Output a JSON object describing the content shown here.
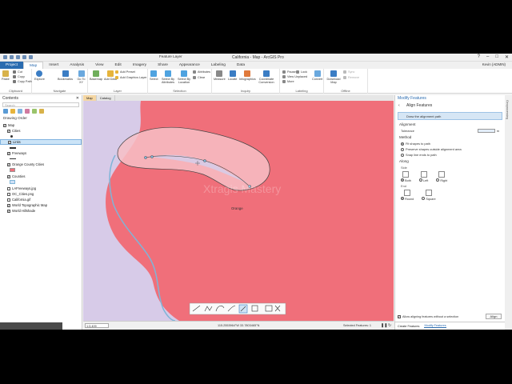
{
  "title_bar": {
    "contextual_tab": "Feature Layer",
    "window_title": "California - Map - ArcGIS Pro",
    "controls": [
      "?",
      "–",
      "□",
      "✕"
    ]
  },
  "ribbon_tabs": [
    "Project",
    "Map",
    "Insert",
    "Analysis",
    "View",
    "Edit",
    "Imagery",
    "Share",
    "Appearance",
    "Labeling",
    "Data"
  ],
  "active_tab": "Map",
  "user": "Kevin (ADMIN)",
  "ribbon": {
    "clipboard": {
      "label": "Clipboard",
      "paste": "Paste",
      "cut": "Cut",
      "copy": "Copy",
      "copy_path": "Copy Path"
    },
    "navigate": {
      "label": "Navigate",
      "explore": "Explore",
      "bookmarks": "Bookmarks",
      "go_to": "Go To XY"
    },
    "layer": {
      "label": "Layer",
      "basemap": "Basemap",
      "add_data": "Add Data",
      "add_preset": "Add Preset",
      "add_graphics": "Add Graphics Layer"
    },
    "selection": {
      "label": "Selection",
      "select": "Select",
      "by_attributes": "Select By Attributes",
      "by_location": "Select By Location",
      "attributes": "Attributes",
      "clear": "Clear"
    },
    "inquiry": {
      "label": "Inquiry",
      "measure": "Measure",
      "locate": "Locate",
      "infographics": "Infographics",
      "coordinate": "Coordinate Conversion"
    },
    "labeling": {
      "label": "Labeling",
      "pause": "Pause",
      "lock": "Lock",
      "view_unplaced": "View Unplaced",
      "more": "More",
      "convert": "Convert"
    },
    "offline": {
      "label": "Offline",
      "download": "Download Map",
      "sync": "Sync",
      "remove": "Remove"
    }
  },
  "contents": {
    "title": "Contents",
    "search_placeholder": "Search",
    "drawing_order": "Drawing Order",
    "layers": [
      {
        "name": "Map",
        "checked": true,
        "indent": 0
      },
      {
        "name": "Cities",
        "checked": true,
        "indent": 1
      },
      {
        "name": "Links",
        "checked": true,
        "indent": 1,
        "selected": true
      },
      {
        "name": "Freeways",
        "checked": true,
        "indent": 1
      },
      {
        "name": "Orange County Cities",
        "checked": true,
        "indent": 1
      },
      {
        "name": "Counties",
        "checked": true,
        "indent": 1
      },
      {
        "name": "LAFreeways.jpg",
        "checked": false,
        "indent": 1
      },
      {
        "name": "OC_Cities.png",
        "checked": false,
        "indent": 1
      },
      {
        "name": "California.gif",
        "checked": false,
        "indent": 1
      },
      {
        "name": "World Topographic Map",
        "checked": true,
        "indent": 1
      },
      {
        "name": "World Hillshade",
        "checked": true,
        "indent": 1
      }
    ]
  },
  "map": {
    "tabs": [
      "Map",
      "Catalog"
    ],
    "feature_label": "Orange",
    "watermark": "Xtragis Mastery",
    "scale": "1:3,409",
    "coordinates": "115.2553964°W 33.7803465°N",
    "selected_features": "Selected Features: 1",
    "colors": {
      "county_fill": "#f06f7a",
      "background": "#d7cbe8",
      "boundary": "#7fb5d8"
    }
  },
  "modify_pane": {
    "pane_title": "Modify Features",
    "tool_title": "Align Features",
    "instruction": "Draw the alignment path",
    "alignment": "Alignment",
    "tolerance_label": "Tolerance",
    "tolerance_unit": "m",
    "method_label": "Method",
    "methods": [
      "Fit shapes to path",
      "Preserve shapes outside alignment area",
      "Snap line ends to path"
    ],
    "selected_method": 0,
    "along_label": "Along",
    "side_label": "Side",
    "sides": [
      "Both",
      "Left",
      "Right"
    ],
    "selected_side": "Both",
    "end_label": "End",
    "ends": [
      "Round",
      "Square"
    ],
    "selected_end": "Round",
    "allow_checkbox": "Allow aligning features without a selection",
    "align_button": "Align",
    "bottom_tabs": [
      "Create Features",
      "Modify Features"
    ]
  },
  "right_strip": "Geoprocessing"
}
